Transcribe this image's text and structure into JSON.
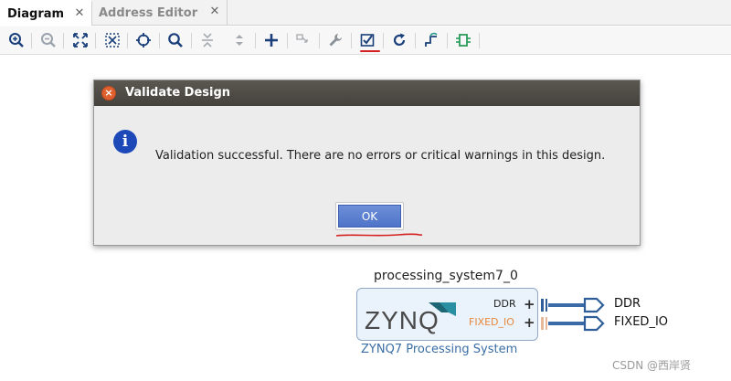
{
  "tabs": [
    {
      "label": "Diagram",
      "close": "✕"
    },
    {
      "label": "Address Editor",
      "close": "✕"
    }
  ],
  "toolbar": {
    "icons": [
      "zoom-in",
      "zoom-out",
      "fit-view",
      "fit-selection",
      "auto-connect",
      "search",
      "collapse-all",
      "expand-all",
      "add-ip",
      "make-connection",
      "settings-wrench",
      "validate-design",
      "regenerate-layout",
      "optimize-routing",
      "add-module"
    ]
  },
  "dialog": {
    "title": "Validate Design",
    "message": "Validation successful. There are no errors or critical warnings in this design.",
    "ok_label": "OK",
    "icon": "info-icon"
  },
  "block": {
    "instance_name": "processing_system7_0",
    "type_label": "ZYNQ7 Processing System",
    "logo_text": "ZYNQ",
    "ports": [
      {
        "name": "DDR",
        "color": "#222222"
      },
      {
        "name": "FIXED_IO",
        "color": "#e8873a"
      }
    ],
    "external_ports": [
      "DDR",
      "FIXED_IO"
    ]
  },
  "watermark": "CSDN @西岸贤",
  "colors": {
    "accent": "#1c48b8",
    "annotation_red": "#d42020",
    "ok_button": "#5a7ccc"
  }
}
